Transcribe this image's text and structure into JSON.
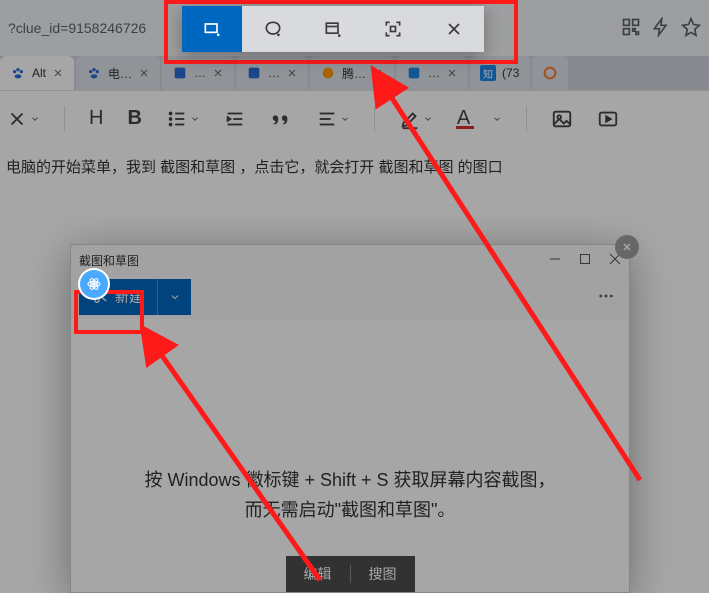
{
  "addressbar": {
    "url_fragment": "?clue_id=9158246726"
  },
  "tabs": [
    {
      "label": "Alt",
      "favicon_color": "#2b6cd4"
    },
    {
      "label": "电…",
      "favicon_color": "#2b6cd4"
    },
    {
      "label": "…",
      "favicon_color": "#2b6cd4"
    },
    {
      "label": "…",
      "favicon_color": "#2b6cd4"
    },
    {
      "label": "腾…",
      "favicon_color": "#ff9a00"
    },
    {
      "label": "…",
      "favicon_color": "#1e88e5"
    },
    {
      "label": "(73",
      "favicon_color": "#1e88e5",
      "badge": "知"
    },
    {
      "label": "",
      "favicon_color": "#ff7a2f"
    }
  ],
  "doc_text": "电脑的开始菜单，我到  截图和草图 ，点击它，就会打开  截图和草图  的图口",
  "snip_popup": {
    "title": "截图和草图",
    "new_label": "新建",
    "tip_line1": "按 Windows 徽标键 + Shift + S 获取屏幕内容截图，",
    "tip_line2": "而无需启动\"截图和草图\"。",
    "edit": "编辑",
    "search_image": "搜图"
  },
  "colors": {
    "accent": "#0067c0",
    "red": "#ff1a1a"
  }
}
